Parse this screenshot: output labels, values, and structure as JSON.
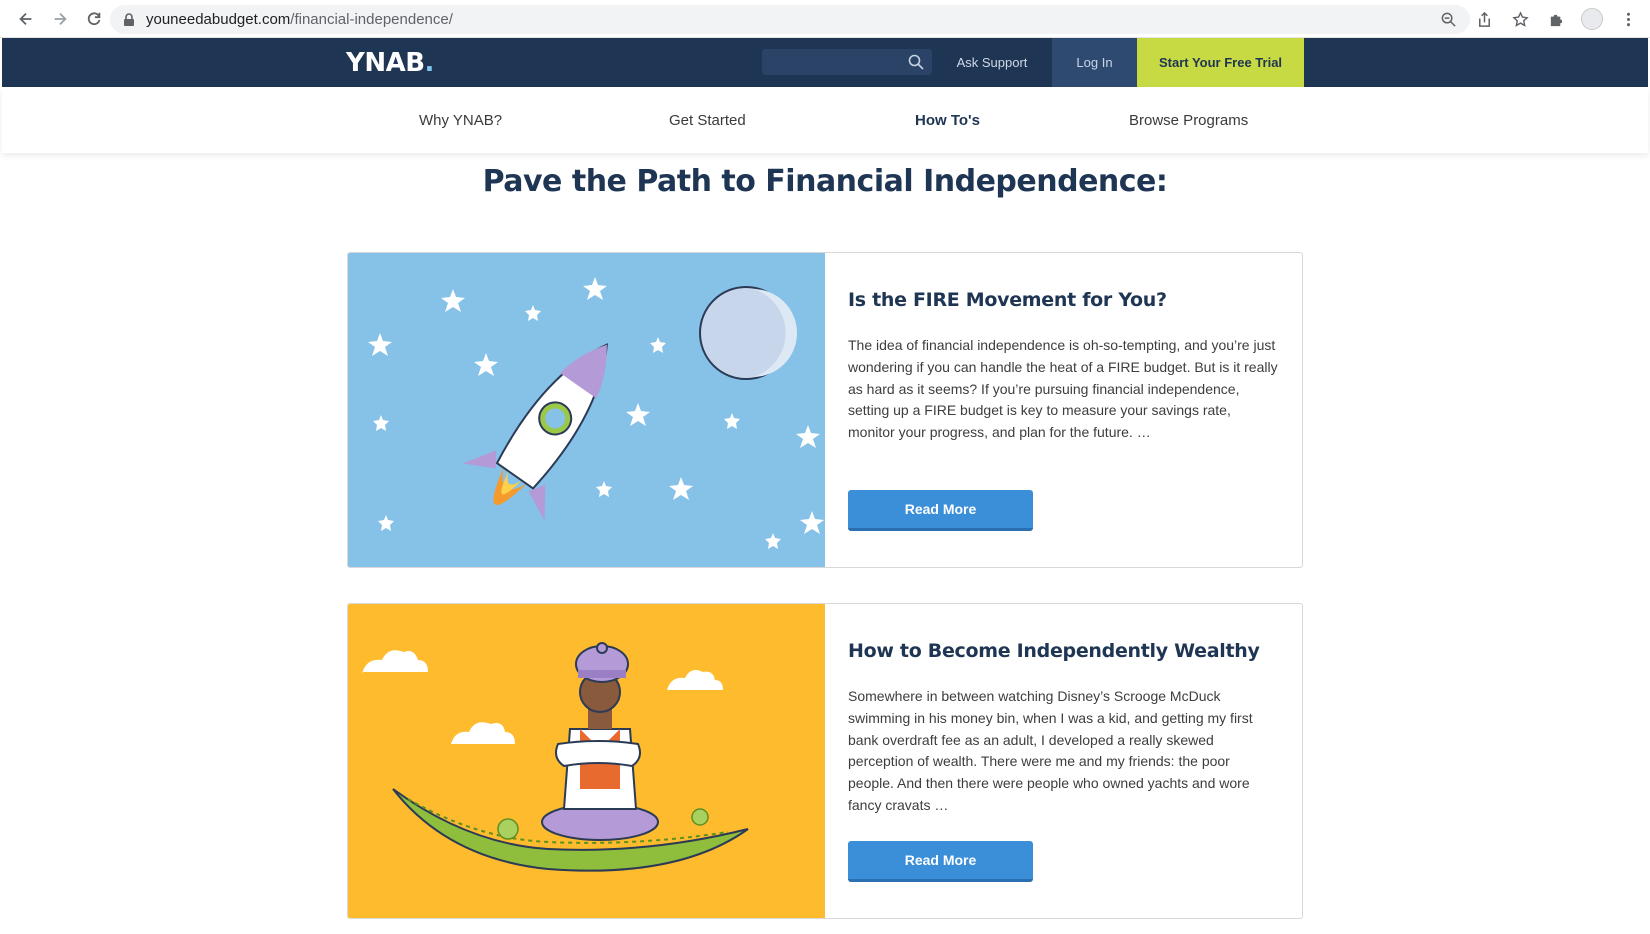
{
  "browser": {
    "url_host": "youneedabudget.com",
    "url_path": "/financial-independence/"
  },
  "header": {
    "logo": "YNAB",
    "logo_dot": ".",
    "ask_support": "Ask Support",
    "login": "Log In",
    "trial": "Start Your Free Trial"
  },
  "subnav": {
    "items": [
      "Why YNAB?",
      "Get Started",
      "How To's",
      "Browse Programs"
    ]
  },
  "page": {
    "title": "Pave the Path to Financial Independence:"
  },
  "cards": [
    {
      "title": "Is the FIRE Movement for You?",
      "text": "The idea of financial independence is oh-so-tempting, and you’re just wondering if you can handle the heat of a FIRE budget. But is it really as hard as it seems? If you’re pursuing financial independence, setting up a FIRE budget is key to measure your savings rate, monitor your progress, and plan for the future. …",
      "button": "Read More",
      "image": "rocket-illustration"
    },
    {
      "title": "How to Become Independently Wealthy",
      "text": "Somewhere in between watching Disney’s Scrooge McDuck swimming in his money bin, when I was a kid, and getting my first bank overdraft fee as an adult, I developed a really skewed perception of wealth. There were me and my friends: the poor people. And then there were people who owned yachts and wore fancy cravats …",
      "button": "Read More",
      "image": "money-carpet-illustration"
    }
  ],
  "colors": {
    "header_bg": "#1f3554",
    "trial_bg": "#c7d943",
    "button_bg": "#3b8fd9",
    "card1_bg": "#86c1e8",
    "card2_bg": "#fdbb2d"
  }
}
